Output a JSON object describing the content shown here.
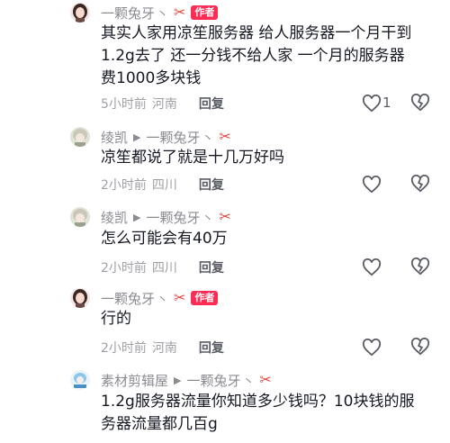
{
  "comments": [
    {
      "author": "一颗兔牙",
      "is_author": true,
      "author_badge": "作者",
      "text": "其实人家用凉笙服务器 给人服务器一个月干到1.2g去了 还一分钱不给人家 一个月的服务器费1000多块钱",
      "time": "5小时前",
      "location": "河南",
      "reply_label": "回复",
      "likes": "1"
    },
    {
      "author": "绫凯",
      "reply_to": "一颗兔牙",
      "text": "凉笙都说了就是十几万好吗",
      "time": "2小时前",
      "location": "四川",
      "reply_label": "回复"
    },
    {
      "author": "绫凯",
      "reply_to": "一颗兔牙",
      "text": "怎么可能会有40万",
      "time": "2小时前",
      "location": "四川",
      "reply_label": "回复"
    },
    {
      "author": "一颗兔牙",
      "is_author": true,
      "author_badge": "作者",
      "text": "行的",
      "time": "2小时前",
      "location": "河南",
      "reply_label": "回复"
    },
    {
      "author": "素材剪辑屋",
      "reply_to": "一颗兔牙",
      "text": "1.2g服务器流量你知道多少钱吗？10块钱的服务器流量都几百g"
    }
  ],
  "icons": {
    "arrow": "play-arrow-icon",
    "scissors": "scissors-icon",
    "like": "heart-outline-icon",
    "dislike": "broken-heart-icon"
  },
  "colors": {
    "badge": "#fe2c55",
    "scissors": "#e3463e",
    "meta": "#8a8b91"
  }
}
